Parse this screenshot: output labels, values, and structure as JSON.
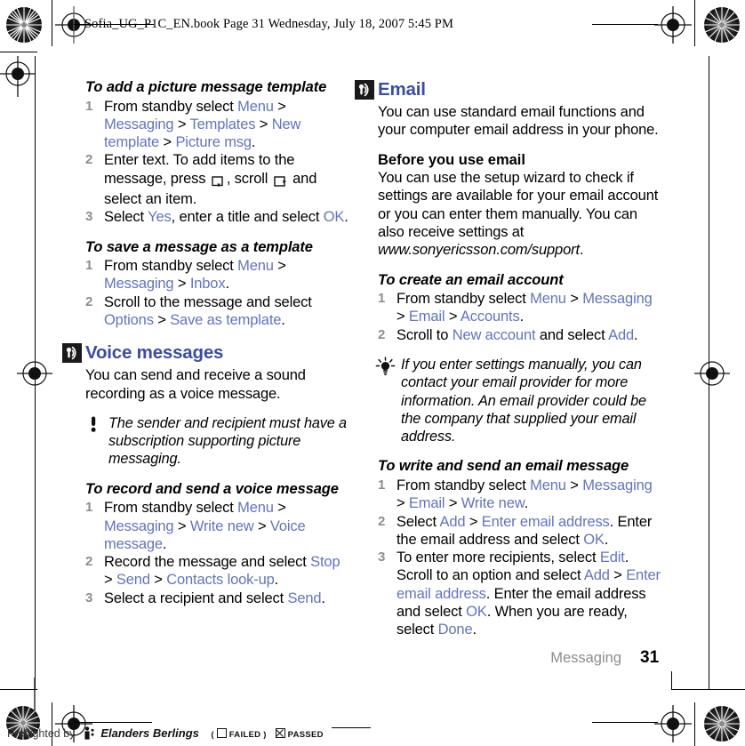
{
  "document": {
    "header_slug": "Sofia_UG_P1C_EN.book  Page 31  Wednesday, July 18, 2007  5:45 PM",
    "footer_chapter": "Messaging",
    "page_number": "31"
  },
  "colors": {
    "link": "#6175bd",
    "heading": "#3b4da0",
    "step_number": "#8d8d8d",
    "footer_chapter": "#8d8d8d"
  },
  "left_column": {
    "proc1": {
      "title": "To add a picture message template",
      "steps": [
        {
          "num": "1",
          "parts": [
            {
              "t": "From standby select ",
              "s": "plain"
            },
            {
              "t": "Menu",
              "s": "link"
            },
            {
              "t": " > ",
              "s": "plain"
            },
            {
              "t": "Messaging",
              "s": "link"
            },
            {
              "t": " > ",
              "s": "plain"
            },
            {
              "t": "Templates",
              "s": "link"
            },
            {
              "t": " > ",
              "s": "plain"
            },
            {
              "t": "New template",
              "s": "link"
            },
            {
              "t": " > ",
              "s": "plain"
            },
            {
              "t": "Picture msg",
              "s": "link"
            },
            {
              "t": ".",
              "s": "plain"
            }
          ]
        },
        {
          "num": "2",
          "parts": [
            {
              "t": "Enter text. To add items to the message, press ",
              "s": "plain"
            },
            {
              "t": "",
              "s": "key-down"
            },
            {
              "t": ", scroll ",
              "s": "plain"
            },
            {
              "t": "",
              "s": "key-right"
            },
            {
              "t": " and select an item.",
              "s": "plain"
            }
          ]
        },
        {
          "num": "3",
          "parts": [
            {
              "t": "Select ",
              "s": "plain"
            },
            {
              "t": "Yes",
              "s": "link"
            },
            {
              "t": ", enter a title and select ",
              "s": "plain"
            },
            {
              "t": "OK",
              "s": "link"
            },
            {
              "t": ".",
              "s": "plain"
            }
          ]
        }
      ]
    },
    "proc2": {
      "title": "To save a message as a template",
      "steps": [
        {
          "num": "1",
          "parts": [
            {
              "t": "From standby select ",
              "s": "plain"
            },
            {
              "t": "Menu",
              "s": "link"
            },
            {
              "t": " > ",
              "s": "plain"
            },
            {
              "t": "Messaging",
              "s": "link"
            },
            {
              "t": " > ",
              "s": "plain"
            },
            {
              "t": "Inbox",
              "s": "link"
            },
            {
              "t": ".",
              "s": "plain"
            }
          ]
        },
        {
          "num": "2",
          "parts": [
            {
              "t": "Scroll to the message and select ",
              "s": "plain"
            },
            {
              "t": "Options",
              "s": "link"
            },
            {
              "t": " > ",
              "s": "plain"
            },
            {
              "t": "Save as template",
              "s": "link"
            },
            {
              "t": ".",
              "s": "plain"
            }
          ]
        }
      ]
    },
    "section": {
      "icon": "voice-message-icon",
      "title": "Voice messages",
      "intro": "You can send and receive a sound recording as a voice message."
    },
    "note": {
      "icon": "exclamation-icon",
      "text": "The sender and recipient must have a subscription supporting picture messaging."
    },
    "proc3": {
      "title": "To record and send a voice message",
      "steps": [
        {
          "num": "1",
          "parts": [
            {
              "t": "From standby select ",
              "s": "plain"
            },
            {
              "t": "Menu",
              "s": "link"
            },
            {
              "t": " > ",
              "s": "plain"
            },
            {
              "t": "Messaging",
              "s": "link"
            },
            {
              "t": " > ",
              "s": "plain"
            },
            {
              "t": "Write new",
              "s": "link"
            },
            {
              "t": " > ",
              "s": "plain"
            },
            {
              "t": "Voice message",
              "s": "link"
            },
            {
              "t": ".",
              "s": "plain"
            }
          ]
        },
        {
          "num": "2",
          "parts": [
            {
              "t": "Record the message and select ",
              "s": "plain"
            },
            {
              "t": "Stop",
              "s": "link"
            },
            {
              "t": " > ",
              "s": "plain"
            },
            {
              "t": "Send",
              "s": "link"
            },
            {
              "t": " > ",
              "s": "plain"
            },
            {
              "t": "Contacts look-up",
              "s": "link"
            },
            {
              "t": ".",
              "s": "plain"
            }
          ]
        },
        {
          "num": "3",
          "parts": [
            {
              "t": "Select a recipient and select ",
              "s": "plain"
            },
            {
              "t": "Send",
              "s": "link"
            },
            {
              "t": ".",
              "s": "plain"
            }
          ]
        }
      ]
    }
  },
  "right_column": {
    "section": {
      "icon": "email-icon",
      "title": "Email",
      "intro": "You can use standard email functions and your computer email address in your phone."
    },
    "subsection": {
      "title": "Before you use email",
      "body_parts": [
        {
          "t": "You can use the setup wizard to check if settings are available for your email account or you can enter them manually. You can also receive settings at ",
          "s": "plain"
        },
        {
          "t": "www.sonyericsson.com/support",
          "s": "italic"
        },
        {
          "t": ".",
          "s": "plain"
        }
      ]
    },
    "proc1": {
      "title": "To create an email account",
      "steps": [
        {
          "num": "1",
          "parts": [
            {
              "t": "From standby select ",
              "s": "plain"
            },
            {
              "t": "Menu",
              "s": "link"
            },
            {
              "t": " > ",
              "s": "plain"
            },
            {
              "t": "Messaging",
              "s": "link"
            },
            {
              "t": " > ",
              "s": "plain"
            },
            {
              "t": "Email",
              "s": "link"
            },
            {
              "t": " > ",
              "s": "plain"
            },
            {
              "t": "Accounts",
              "s": "link"
            },
            {
              "t": ".",
              "s": "plain"
            }
          ]
        },
        {
          "num": "2",
          "parts": [
            {
              "t": "Scroll to ",
              "s": "plain"
            },
            {
              "t": "New account",
              "s": "link"
            },
            {
              "t": " and select ",
              "s": "plain"
            },
            {
              "t": "Add",
              "s": "link"
            },
            {
              "t": ".",
              "s": "plain"
            }
          ]
        }
      ]
    },
    "tip": {
      "icon": "lightbulb-tip-icon",
      "text": "If you enter settings manually, you can contact your email provider for more information. An email provider could be the company that supplied your email address."
    },
    "proc2": {
      "title": "To write and send an email message",
      "steps": [
        {
          "num": "1",
          "parts": [
            {
              "t": "From standby select ",
              "s": "plain"
            },
            {
              "t": "Menu",
              "s": "link"
            },
            {
              "t": " > ",
              "s": "plain"
            },
            {
              "t": "Messaging",
              "s": "link"
            },
            {
              "t": " > ",
              "s": "plain"
            },
            {
              "t": "Email",
              "s": "link"
            },
            {
              "t": " > ",
              "s": "plain"
            },
            {
              "t": "Write new",
              "s": "link"
            },
            {
              "t": ".",
              "s": "plain"
            }
          ]
        },
        {
          "num": "2",
          "parts": [
            {
              "t": "Select ",
              "s": "plain"
            },
            {
              "t": "Add",
              "s": "link"
            },
            {
              "t": " > ",
              "s": "plain"
            },
            {
              "t": "Enter email address",
              "s": "link"
            },
            {
              "t": ". Enter the email address and select ",
              "s": "plain"
            },
            {
              "t": "OK",
              "s": "link"
            },
            {
              "t": ".",
              "s": "plain"
            }
          ]
        },
        {
          "num": "3",
          "parts": [
            {
              "t": "To enter more recipients, select ",
              "s": "plain"
            },
            {
              "t": "Edit",
              "s": "link"
            },
            {
              "t": ". Scroll to an option and select ",
              "s": "plain"
            },
            {
              "t": "Add",
              "s": "link"
            },
            {
              "t": " > ",
              "s": "plain"
            },
            {
              "t": "Enter email address",
              "s": "link"
            },
            {
              "t": ". Enter the email address and select ",
              "s": "plain"
            },
            {
              "t": "OK",
              "s": "link"
            },
            {
              "t": ". When you are ready, select ",
              "s": "plain"
            },
            {
              "t": "Done",
              "s": "link"
            },
            {
              "t": ".",
              "s": "plain"
            }
          ]
        }
      ]
    }
  },
  "preflight": {
    "by_label": "Preflighted by",
    "company": "Elanders Berlings",
    "failed_label": "FAILED",
    "passed_label": "PASSED",
    "open_paren": "(",
    "close_paren": ")"
  }
}
